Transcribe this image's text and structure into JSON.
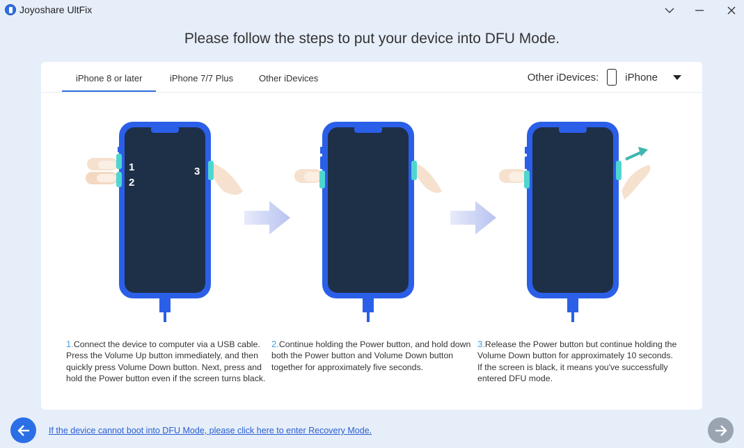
{
  "window": {
    "title": "Joyoshare UltFix",
    "icons": [
      "app-icon",
      "chevron-down-icon",
      "minimize-icon",
      "close-icon"
    ]
  },
  "page_title": "Please follow the steps to put your device into DFU Mode.",
  "tabs": [
    {
      "label": "iPhone 8 or later",
      "active": true
    },
    {
      "label": "iPhone 7/7 Plus",
      "active": false
    },
    {
      "label": "Other iDevices",
      "active": false
    }
  ],
  "device_selector": {
    "label": "Other iDevices:",
    "value": "iPhone"
  },
  "steps": [
    {
      "number": "1.",
      "text": "Connect the device to computer via a USB cable. Press the Volume Up button immediately, and then quickly press Volume Down button. Next, press and hold the Power button even if the screen turns black.",
      "badges": [
        "1",
        "2",
        "3"
      ]
    },
    {
      "number": "2.",
      "text": "Continue holding the Power button, and hold down both the Power button and Volume Down button together for approximately five seconds."
    },
    {
      "number": "3.",
      "text": "Release the Power button but continue holding the Volume Down button for approximately 10 seconds. If the screen is black, it means you've successfully entered DFU mode."
    }
  ],
  "recovery_link": "If the device cannot boot into DFU Mode, please click here to enter Recovery Mode.",
  "colors": {
    "accent": "#2f6fe4",
    "phone_frame": "#2b5fe8",
    "screen": "#1e2f48",
    "button_highlight": "#4fd6d0"
  }
}
